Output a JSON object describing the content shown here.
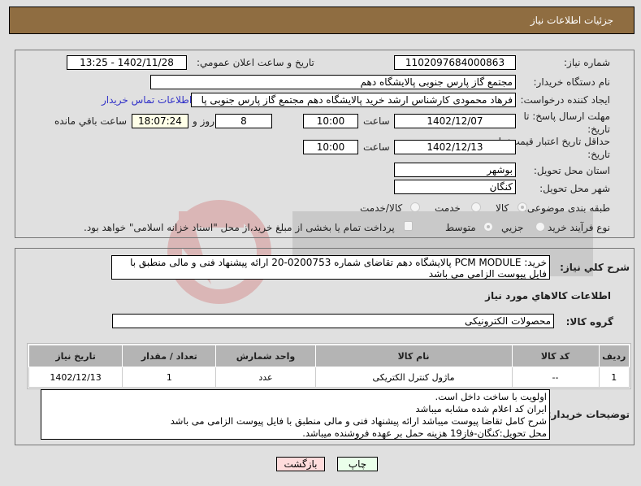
{
  "header": {
    "title": "جزئيات اطلاعات نياز"
  },
  "fields": {
    "need_number_label": "شماره نياز:",
    "need_number": "1102097684000863",
    "announce_label": "تاريخ و ساعت اعلان عمومي:",
    "announce_value": "1402/11/28 - 13:25",
    "buyer_org_label": "نام دستگاه خريدار:",
    "buyer_org": "مجتمع گاز پارس جنوبی  پالایشگاه دهم",
    "requester_label": "ايجاد کننده درخواست:",
    "requester": "فرهاد محمودی کارشناس ارشد خرید پالایشگاه دهم  مجتمع گاز پارس جنوبی  پا",
    "contact_link": "اطلاعات تماس خريدار",
    "deadline_label_1": "مهلت ارسال پاسخ: تا",
    "deadline_label_2": "تاريخ:",
    "deadline_date": "1402/12/07",
    "time_label": "ساعت",
    "deadline_time": "10:00",
    "days_value": "8",
    "days_label": "روز و",
    "remaining_time": "18:07:24",
    "remaining_label": "ساعت باقي مانده",
    "validity_label_1": "حداقل تاريخ اعتبار قيمت: تا",
    "validity_label_2": "تاريخ:",
    "validity_date": "1402/12/13",
    "validity_time": "10:00",
    "province_label": "استان محل تحويل:",
    "province": "بوشهر",
    "city_label": "شهر محل تحويل:",
    "city": "کنگان",
    "category_label": "طبقه بندی موضوعی:",
    "category_options": [
      "کالا",
      "خدمت",
      "کالا/خدمت"
    ],
    "category_selected": "کالا",
    "process_label": "نوع فرآيند خريد :",
    "process_options": [
      "جزيي",
      "متوسط"
    ],
    "process_selected": "متوسط",
    "treasury_note": "پرداخت تمام يا بخشی از مبلغ خريد،از محل \"اسناد خزانه اسلامی\" خواهد بود."
  },
  "summary": {
    "label": "شرح کلي نياز:",
    "text": "خريد: PCM MODULE پالایشگاه دهم تقاضای شماره 0200753-20 ارائه پیشنهاد فنی و مالی منطبق با فایل پیوست الزامی می باشد"
  },
  "goods": {
    "section_title": "اطلاعات کالاهاي مورد نياز",
    "group_label": "گروه کالا:",
    "group_value": "محصولات الکترونيکی",
    "columns": [
      "رديف",
      "کد کالا",
      "نام کالا",
      "واحد شمارش",
      "تعداد / مقدار",
      "تاريخ نياز"
    ],
    "rows": [
      [
        "1",
        "--",
        "ماژول کنترل الکتریکی",
        "عدد",
        "1",
        "1402/12/13"
      ]
    ]
  },
  "buyer_notes": {
    "label": "توضيحات خريدار:",
    "lines": [
      "اولویت با ساخت داخل است.",
      "ایران کد اعلام شده مشابه میباشد",
      "شرح کامل تقاضا پیوست میباشد ارائه پیشنهاد فنی و مالی منطبق با فایل پیوست الزامی می باشد",
      "محل تحویل:کنگان-فاز19 هزینه حمل بر عهده فروشنده میباشد."
    ]
  },
  "buttons": {
    "print": "چاپ",
    "back": "بازگشت"
  },
  "colors": {
    "header": "#8f6d41",
    "link": "#3232c8",
    "print_bg": "#eaffea",
    "back_bg": "#ffdcdc"
  }
}
